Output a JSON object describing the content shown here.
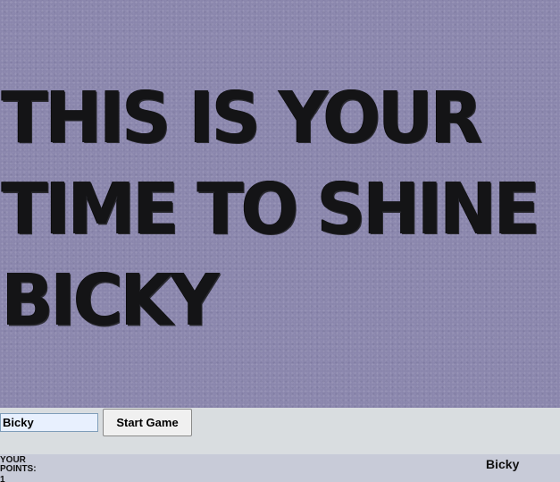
{
  "hero": {
    "line1": "THIS IS YOUR",
    "line2": "TIME TO SHINE",
    "line3": "BICKY"
  },
  "controls": {
    "name_value": "Bicky",
    "start_label": "Start Game"
  },
  "scorebar": {
    "points_label": "YOUR POINTS:",
    "points_value": "1",
    "player_name": "Bicky"
  },
  "colors": {
    "hero_background": "#8985ac",
    "hero_text": "#141416",
    "controls_background": "#d9dde0",
    "scorebar_background": "#c8cbd8"
  }
}
